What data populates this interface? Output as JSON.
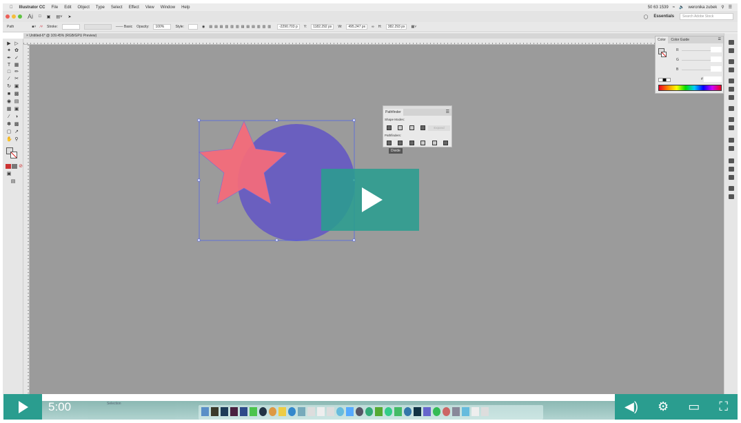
{
  "menubar": {
    "app": "Illustrator CC",
    "items": [
      "File",
      "Edit",
      "Object",
      "Type",
      "Select",
      "Effect",
      "View",
      "Window",
      "Help"
    ],
    "status": "50 63 1539",
    "user": "weronika zubek"
  },
  "titlebar": {
    "app_icon": "Ai",
    "workspace": "Essentials",
    "search_placeholder": "Search Adobe Stock"
  },
  "control": {
    "selection": "Path",
    "stroke_label": "Stroke:",
    "brush": "Basic",
    "opacity_label": "Opacity:",
    "opacity": "100%",
    "style_label": "Style:",
    "x": "-2290.703 p",
    "y_label": "Y:",
    "y": "1182.292 px",
    "w_label": "W:",
    "w": "495.247 px",
    "h_label": "H:",
    "h": "382.293 px"
  },
  "document": {
    "tab": "Untitled-6* @ 109.45% (RGB/GPU Preview)"
  },
  "color_panel": {
    "tabs": [
      "Color",
      "Color Guide"
    ],
    "channels": [
      "R",
      "G",
      "B"
    ],
    "hex_label": "#"
  },
  "pathfinder": {
    "title": "Pathfinder",
    "shape_modes": "Shape Modes:",
    "expand": "Expand",
    "pathfinders": "Pathfinders:",
    "tooltip": "Divide"
  },
  "statusbar": {
    "mode": "Selection"
  },
  "video": {
    "time": "5:00"
  },
  "colors": {
    "accent": "#2a9d8f",
    "circle": "#6a5fbf",
    "star": "#f56b7a",
    "canvas": "#9b9b9b"
  }
}
